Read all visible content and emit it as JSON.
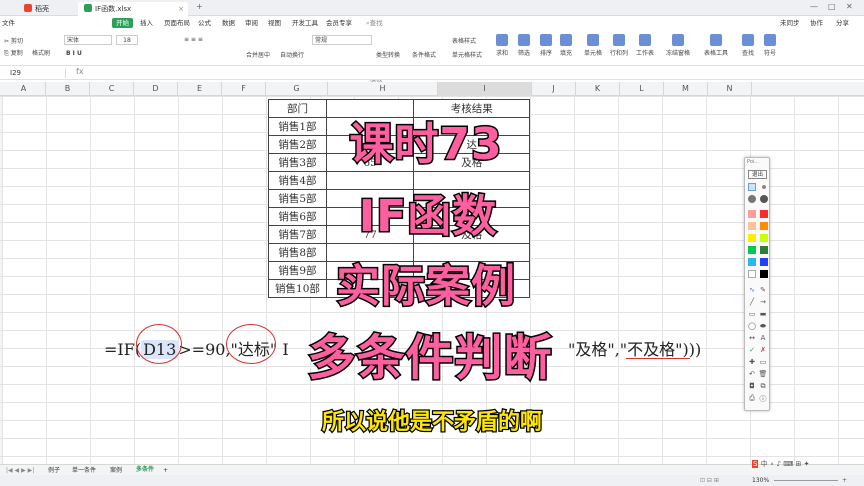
{
  "titlebar": {
    "tab_home": "稻壳",
    "tab_file": "IF函数.xlsx",
    "window_right": [
      "—",
      "□",
      "✕"
    ]
  },
  "menubar": {
    "file": "文件",
    "start": "开始",
    "items": [
      "插入",
      "页面布局",
      "公式",
      "数据",
      "审阅",
      "视图",
      "开发工具",
      "会员专享"
    ],
    "search": "查找命令、搜索模板",
    "right": [
      "未同步",
      "协作",
      "分享"
    ]
  },
  "ribbon": {
    "font_name": "宋体",
    "font_size": "18",
    "groups": [
      "剪切",
      "复制",
      "格式刷",
      "合并居中",
      "自动换行",
      "常规",
      "类型转换",
      "条件格式",
      "表格样式",
      "单元格样式",
      "求和",
      "筛选",
      "排序",
      "填充",
      "单元格",
      "行和列",
      "工作表",
      "冻结窗格",
      "表格工具",
      "查找",
      "符号"
    ]
  },
  "formulabar": {
    "namebox": "I29",
    "fx": "fx"
  },
  "columns": [
    "A",
    "B",
    "C",
    "D",
    "E",
    "F",
    "G",
    "H",
    "I",
    "J",
    "K",
    "L",
    "M",
    "N"
  ],
  "table": {
    "headers": [
      "部门",
      "",
      "考核结果"
    ],
    "rows": [
      [
        "销售1部",
        "",
        ""
      ],
      [
        "销售2部",
        "",
        "达"
      ],
      [
        "销售3部",
        "65",
        "及格"
      ],
      [
        "销售4部",
        "",
        ""
      ],
      [
        "销售5部",
        "",
        ""
      ],
      [
        "销售6部",
        "2",
        ""
      ],
      [
        "销售7部",
        "77",
        "及格"
      ],
      [
        "销售8部",
        "",
        ""
      ],
      [
        "销售9部",
        "",
        ""
      ],
      [
        "销售10部",
        "",
        ""
      ]
    ]
  },
  "formula": {
    "part1": "=IF(",
    "ref": "D13",
    "part2": ">=90,\"达标\"",
    "part3": "I",
    "tail": "\"及格\",\"不及格\")))"
  },
  "overlay": {
    "line1": "课时73",
    "line2": "IF函数",
    "line3": "实际案例",
    "line4": "多条件判断",
    "subtitle": "所以说他是不矛盾的啊"
  },
  "drawpanel": {
    "title": "Poi...",
    "exit": "退出",
    "colors": [
      "#ff9c9c",
      "#ff2b2b",
      "#ffc09c",
      "#ff8c00",
      "#ffee00",
      "#ccff00",
      "#00c853",
      "#2e7d32",
      "#29b6f6",
      "#1e40ff",
      "#ffffff",
      "#000000"
    ]
  },
  "sheets": {
    "tabs": [
      "例子",
      "单一条件",
      "案例",
      "多条件"
    ],
    "active": "多条件",
    "add": "+"
  },
  "statusbar": {
    "zoom": "130%"
  }
}
